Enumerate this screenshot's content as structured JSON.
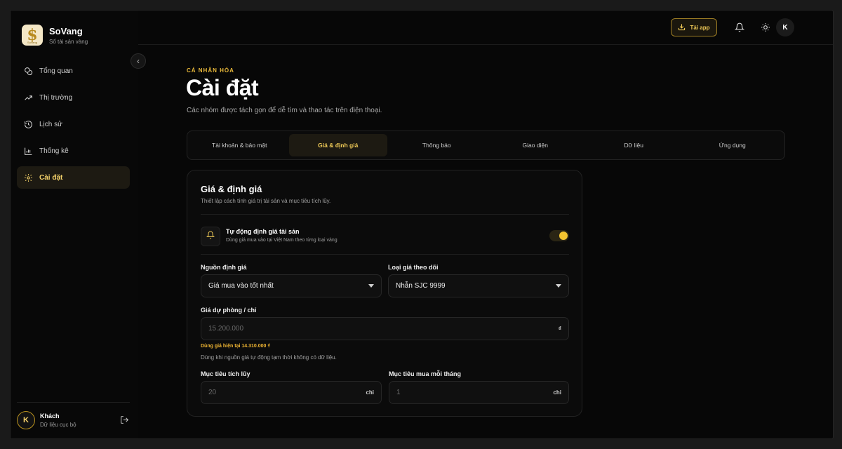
{
  "brand": {
    "name": "SoVang",
    "subtitle": "Sổ tài sản vàng",
    "logo_text": "SoVang"
  },
  "sidebar": {
    "items": [
      {
        "label": "Tổng quan",
        "icon": "coins-icon"
      },
      {
        "label": "Thị trường",
        "icon": "trending-up-icon"
      },
      {
        "label": "Lịch sử",
        "icon": "history-icon"
      },
      {
        "label": "Thống kê",
        "icon": "bar-chart-icon"
      },
      {
        "label": "Cài đặt",
        "icon": "gear-icon",
        "active": true
      }
    ],
    "user": {
      "initial": "K",
      "name": "Khách",
      "subtitle": "Dữ liệu cục bộ"
    }
  },
  "header": {
    "download_label": "Tải app",
    "avatar_initial": "K"
  },
  "page": {
    "eyebrow": "CÁ NHÂN HÓA",
    "title": "Cài đặt",
    "description": "Các nhóm được tách gọn để dễ tìm và thao tác trên điện thoại."
  },
  "tabs": [
    {
      "label": "Tài khoản & bảo mật"
    },
    {
      "label": "Giá & định giá",
      "active": true
    },
    {
      "label": "Thông báo"
    },
    {
      "label": "Giao diện"
    },
    {
      "label": "Dữ liệu"
    },
    {
      "label": "Ứng dụng"
    }
  ],
  "card": {
    "title": "Giá & định giá",
    "subtitle": "Thiết lập cách tính giá trị tài sản và mục tiêu tích lũy.",
    "auto_price": {
      "title": "Tự động định giá tài sản",
      "subtitle": "Dùng giá mua vào tại Việt Nam theo từng loại vàng",
      "enabled": true
    },
    "price_source": {
      "label": "Nguồn định giá",
      "value": "Giá mua vào tốt nhất"
    },
    "price_type": {
      "label": "Loại giá theo dõi",
      "value": "Nhẫn SJC 9999"
    },
    "fallback_price": {
      "label": "Giá dự phòng / chỉ",
      "placeholder": "15.200.000",
      "unit": "₫",
      "current_hint": "Dùng giá hiện tại 14.310.000 ₫",
      "note": "Dùng khi nguồn giá tự động tạm thời không có dữ liệu."
    },
    "target": {
      "label": "Mục tiêu tích lũy",
      "placeholder": "20",
      "unit": "chỉ"
    },
    "monthly_target": {
      "label": "Mục tiêu mua mỗi tháng",
      "placeholder": "1",
      "unit": "chỉ"
    }
  },
  "colors": {
    "accent": "#f3cd58",
    "background": "#070707",
    "active_bg": "#1d1a12"
  }
}
